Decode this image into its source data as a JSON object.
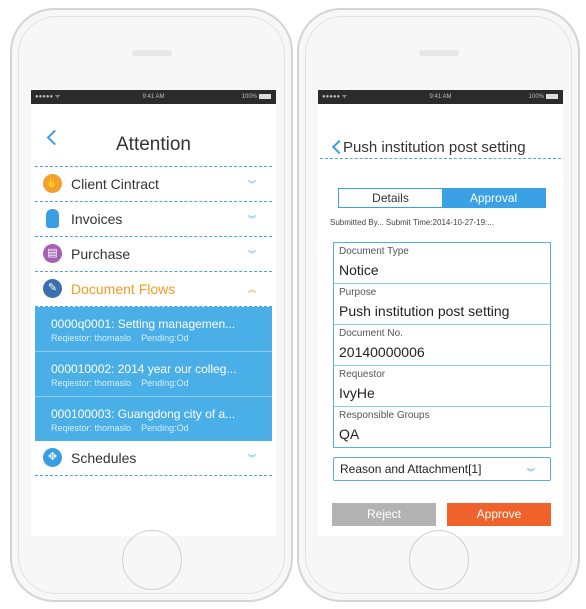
{
  "status_bar": {
    "signal": "●●●●● ᯤ",
    "time": "9:41 AM",
    "battery": "100%"
  },
  "left_screen": {
    "title": "Attention",
    "rows": [
      {
        "label": "Client Cintract",
        "icon": "handshake-icon",
        "icon_color": "#f0a030"
      },
      {
        "label": "Invoices",
        "icon": "bottle-icon",
        "icon_color": "#3a9ee4"
      },
      {
        "label": "Purchase",
        "icon": "basket-icon",
        "icon_color": "#a65fb5"
      },
      {
        "label": "Document Flows",
        "icon": "edit-icon",
        "icon_color": "#3a9ee4",
        "active": true
      }
    ],
    "flows": [
      {
        "title": "0000q0001: Setting managemen...",
        "requestor": "Reqiestor: thomaslo",
        "pending": "Pending:Od"
      },
      {
        "title": "000010002: 2014 year our colleg...",
        "requestor": "Reqiestor: thomaslo",
        "pending": "Pending:Od"
      },
      {
        "title": "000100003: Guangdong city of a...",
        "requestor": "Reqiestor: thomaslo",
        "pending": "Pending:Od"
      }
    ],
    "schedules_label": "Schedules"
  },
  "right_screen": {
    "title": "Push institution post setting",
    "tabs": {
      "details": "Details",
      "approval": "Approval"
    },
    "submitted_line": "Submitted By... Submit Time:2014-10-27-19:...",
    "fields": [
      {
        "key": "Document Type",
        "value": "Notice"
      },
      {
        "key": "Purpose",
        "value": "Push institution post setting"
      },
      {
        "key": "Document No.",
        "value": "20140000006"
      },
      {
        "key": "Requestor",
        "value": "IvyHe"
      },
      {
        "key": "Responsible Groups",
        "value": "QA"
      }
    ],
    "reason_label": "Reason and Attachment[1]",
    "reject_label": "Reject",
    "approve_label": "Approve"
  },
  "colors": {
    "accent": "#3aa1e4",
    "active": "#f39a21",
    "approve": "#f0622b",
    "reject": "#b3b3b3"
  }
}
